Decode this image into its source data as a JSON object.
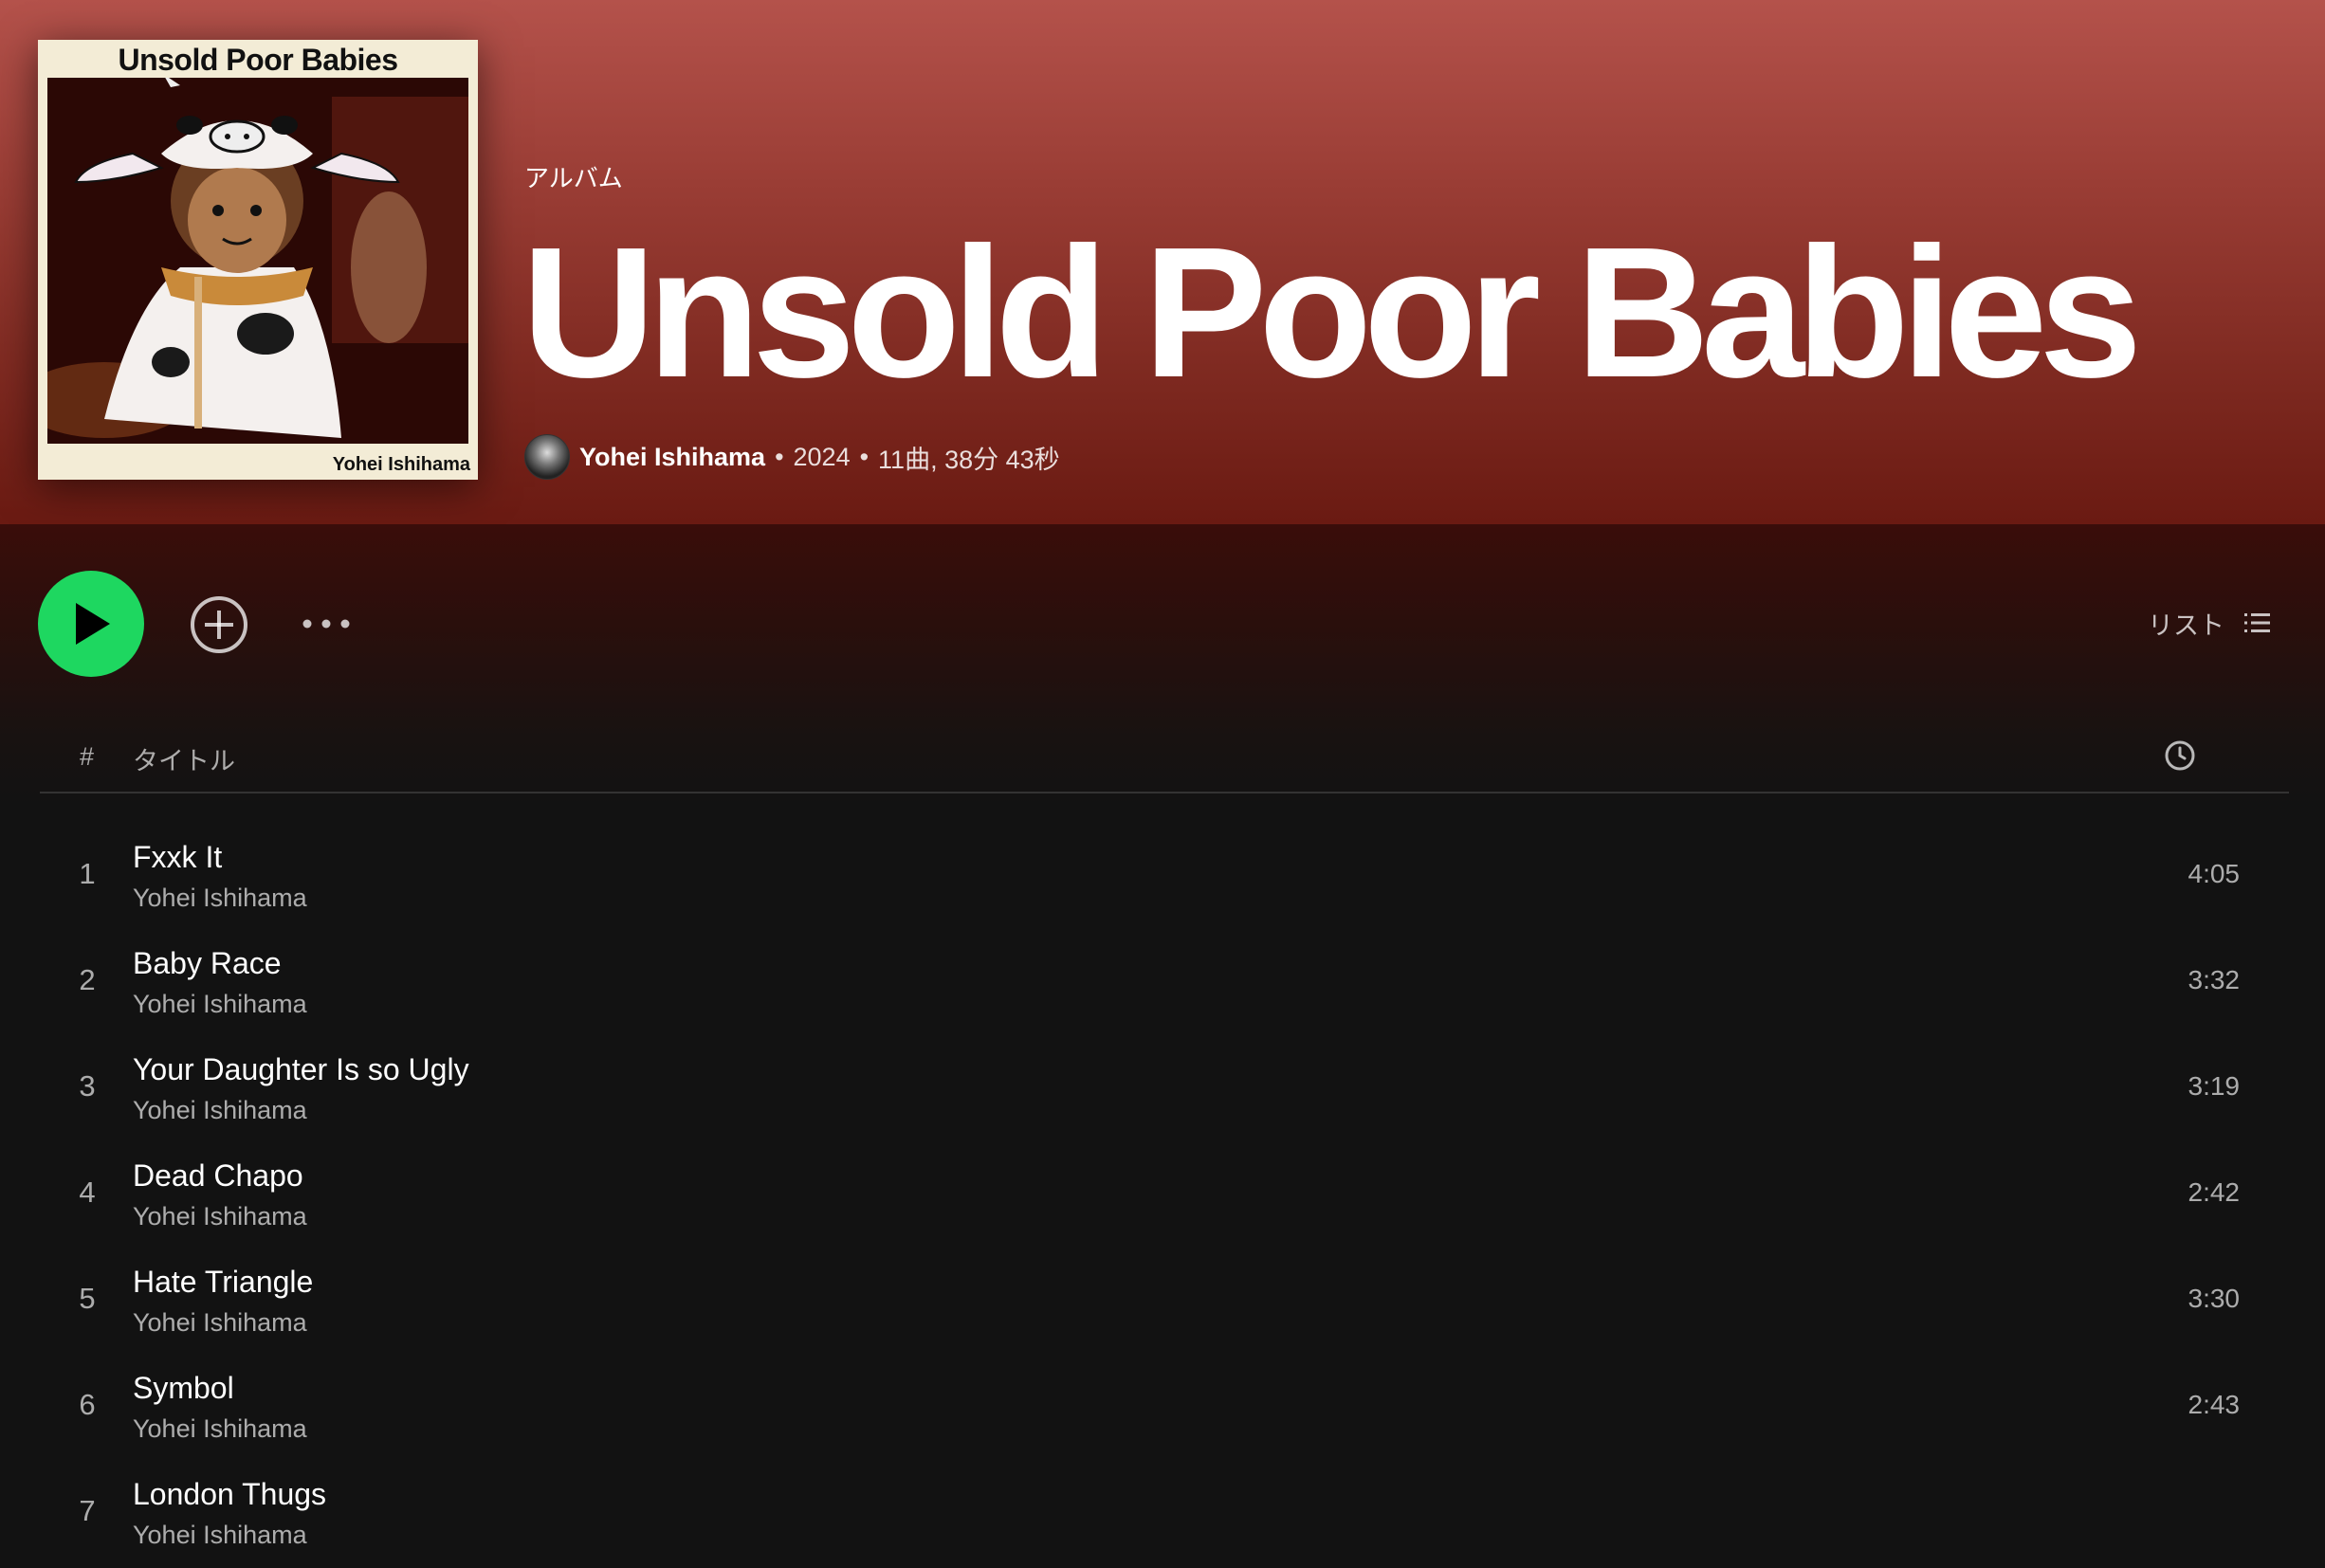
{
  "album": {
    "type_label": "アルバム",
    "title": "Unsold Poor Babies",
    "artist": "Yohei Ishihama",
    "year": "2024",
    "summary": "11曲, 38分 43秒",
    "cover_title": "Unsold Poor Babies",
    "cover_artist": "Yohei Ishihama"
  },
  "actions": {
    "view_label": "リスト"
  },
  "table": {
    "col_num": "#",
    "col_title": "タイトル"
  },
  "tracks": [
    {
      "num": "1",
      "title": "Fxxk It",
      "artist": "Yohei Ishihama",
      "duration": "4:05"
    },
    {
      "num": "2",
      "title": "Baby Race",
      "artist": "Yohei Ishihama",
      "duration": "3:32"
    },
    {
      "num": "3",
      "title": "Your Daughter Is so Ugly",
      "artist": "Yohei Ishihama",
      "duration": "3:19"
    },
    {
      "num": "4",
      "title": "Dead Chapo",
      "artist": "Yohei Ishihama",
      "duration": "2:42"
    },
    {
      "num": "5",
      "title": "Hate Triangle",
      "artist": "Yohei Ishihama",
      "duration": "3:30"
    },
    {
      "num": "6",
      "title": "Symbol",
      "artist": "Yohei Ishihama",
      "duration": "2:43"
    },
    {
      "num": "7",
      "title": "London Thugs",
      "artist": "Yohei Ishihama",
      "duration": ""
    }
  ],
  "colors": {
    "accent": "#1ed760",
    "header_top": "#b4524b",
    "header_bottom": "#6a1a12",
    "background": "#121212"
  },
  "icons": [
    "play-icon",
    "add-circle-icon",
    "more-icon",
    "list-view-icon",
    "clock-icon"
  ]
}
